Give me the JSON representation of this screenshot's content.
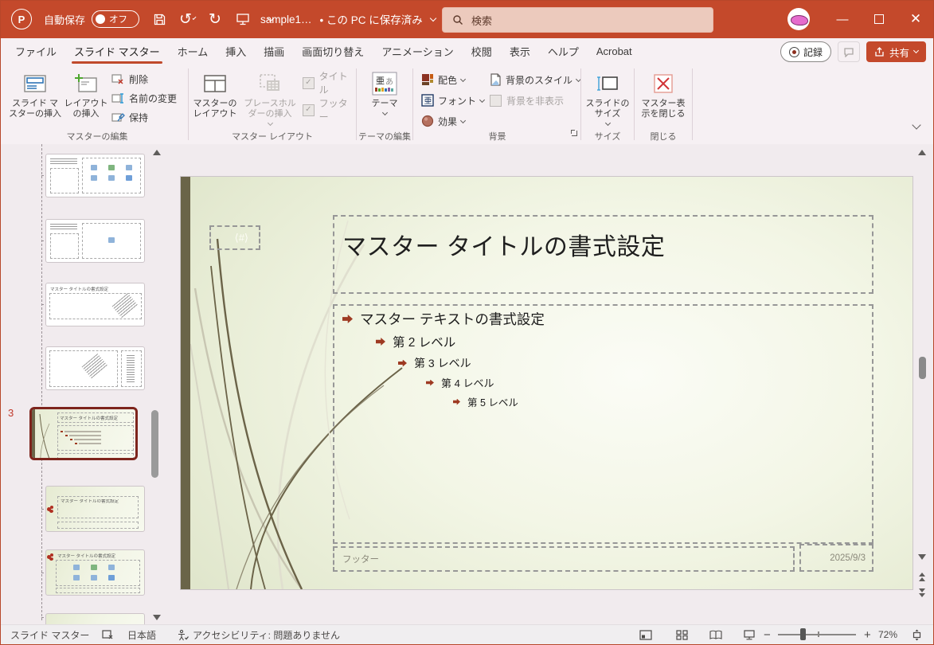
{
  "titlebar": {
    "app": "PowerPoint",
    "autosave_label": "自動保存",
    "autosave_state": "オフ",
    "document_title": "sample1…",
    "save_status": "• この PC に保存済み",
    "search_placeholder": "検索"
  },
  "tabs": {
    "items": [
      {
        "label": "ファイル"
      },
      {
        "label": "スライド マスター"
      },
      {
        "label": "ホーム"
      },
      {
        "label": "挿入"
      },
      {
        "label": "描画"
      },
      {
        "label": "画面切り替え"
      },
      {
        "label": "アニメーション"
      },
      {
        "label": "校閲"
      },
      {
        "label": "表示"
      },
      {
        "label": "ヘルプ"
      },
      {
        "label": "Acrobat"
      }
    ],
    "record_label": "記録",
    "share_label": "共有"
  },
  "ribbon": {
    "edit_master": {
      "group_label": "マスターの編集",
      "insert_slide_master": "スライド マスターの挿入",
      "insert_layout": "レイアウトの挿入",
      "delete": "削除",
      "rename": "名前の変更",
      "preserve": "保持"
    },
    "master_layout": {
      "group_label": "マスター レイアウト",
      "master_layout": "マスターのレイアウト",
      "insert_placeholder": "プレースホルダーの挿入",
      "title_checkbox": "タイトル",
      "footer_checkbox": "フッター"
    },
    "edit_theme": {
      "group_label": "テーマの編集",
      "themes": "テーマ",
      "theme_icon_text": "亜あ"
    },
    "background": {
      "group_label": "背景",
      "color_scheme": "配色",
      "fonts": "フォント",
      "fonts_icon_text": "亜",
      "effects": "効果",
      "background_styles": "背景のスタイル",
      "hide_background": "背景を非表示"
    },
    "size": {
      "group_label": "サイズ",
      "slide_size": "スライドのサイズ"
    },
    "close": {
      "group_label": "閉じる",
      "close_master": "マスター表示を閉じる"
    }
  },
  "thumbnails": {
    "selected_number": "3",
    "mini_title": "マスター タイトルの書式設定"
  },
  "slide": {
    "number_placeholder": "⟨#⟩",
    "title": "マスター タイトルの書式設定",
    "bullets": [
      {
        "text": "マスター テキストの書式設定"
      },
      {
        "text": "第 2 レベル"
      },
      {
        "text": "第 3 レベル"
      },
      {
        "text": "第 4 レベル"
      },
      {
        "text": "第 5 レベル"
      }
    ],
    "footer_placeholder": "フッター",
    "date": "2025/9/3"
  },
  "statusbar": {
    "view_name": "スライド マスター",
    "language": "日本語",
    "accessibility": "アクセシビリティ: 問題ありません",
    "zoom_level": "72%"
  },
  "colors": {
    "titlebar": "#c4492b",
    "accent": "#b7472a",
    "slide_bar": "#6a6448",
    "bullet": "#9e3a22",
    "selection_border": "#7d241c"
  }
}
